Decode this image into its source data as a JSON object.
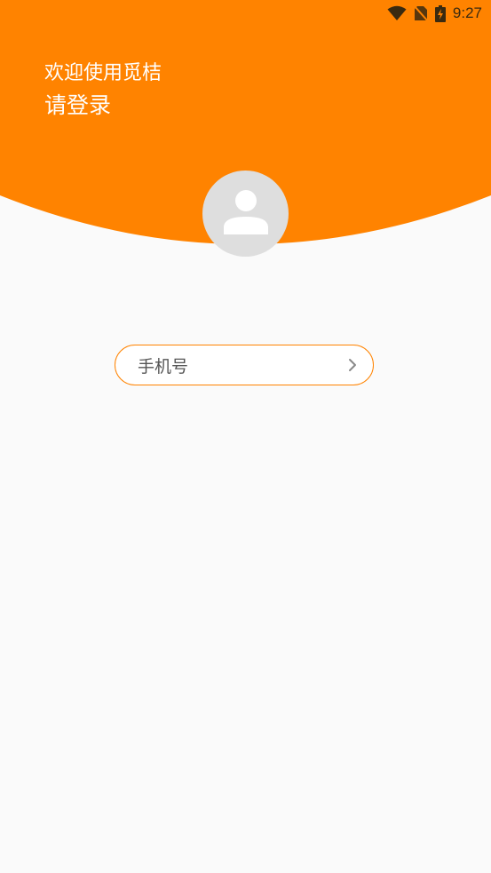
{
  "colors": {
    "brand": "#ff8300",
    "background": "#fafafa",
    "avatar_bg": "#dedede",
    "avatar_fg": "#ffffff",
    "status_icons": "#3a2a10"
  },
  "status_bar": {
    "time": "9:27",
    "icons": [
      "wifi-icon",
      "no-sim-icon",
      "battery-charging-icon"
    ]
  },
  "header": {
    "welcome": "欢迎使用觅桔",
    "prompt": "请登录"
  },
  "avatar": {
    "icon": "user-icon"
  },
  "login": {
    "phone_label": "手机号",
    "chevron_icon": "chevron-right-icon"
  }
}
